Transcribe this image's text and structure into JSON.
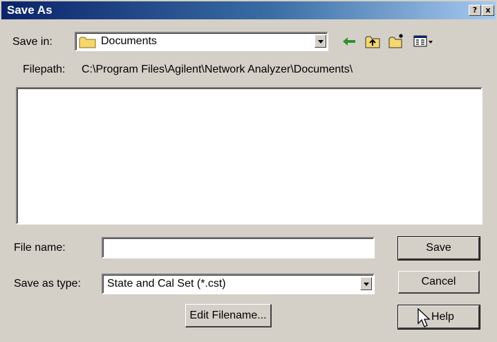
{
  "window": {
    "title": "Save As",
    "help_glyph": "?",
    "close_glyph": "x"
  },
  "save_in": {
    "label": "Save in:",
    "value": "Documents",
    "icon": "folder-icon"
  },
  "toolbar": {
    "icons": [
      "back-arrow-icon",
      "up-one-level-icon",
      "new-folder-icon",
      "view-menu-icon"
    ]
  },
  "filepath": {
    "label": "Filepath:",
    "value": "C:\\Program Files\\Agilent\\Network Analyzer\\Documents\\"
  },
  "file_list": {
    "items": []
  },
  "file_name": {
    "label": "File name:",
    "value": ""
  },
  "save_as_type": {
    "label": "Save as type:",
    "value": "State and Cal Set (*.cst)"
  },
  "buttons": {
    "save": "Save",
    "cancel": "Cancel",
    "help": "Help",
    "edit_filename": "Edit Filename..."
  },
  "colors": {
    "title_start": "#0a246a",
    "title_end": "#a6caf0",
    "face": "#d4d0c8",
    "folder_yellow": "#f5d76e",
    "arrow_green": "#2f8f2f"
  }
}
